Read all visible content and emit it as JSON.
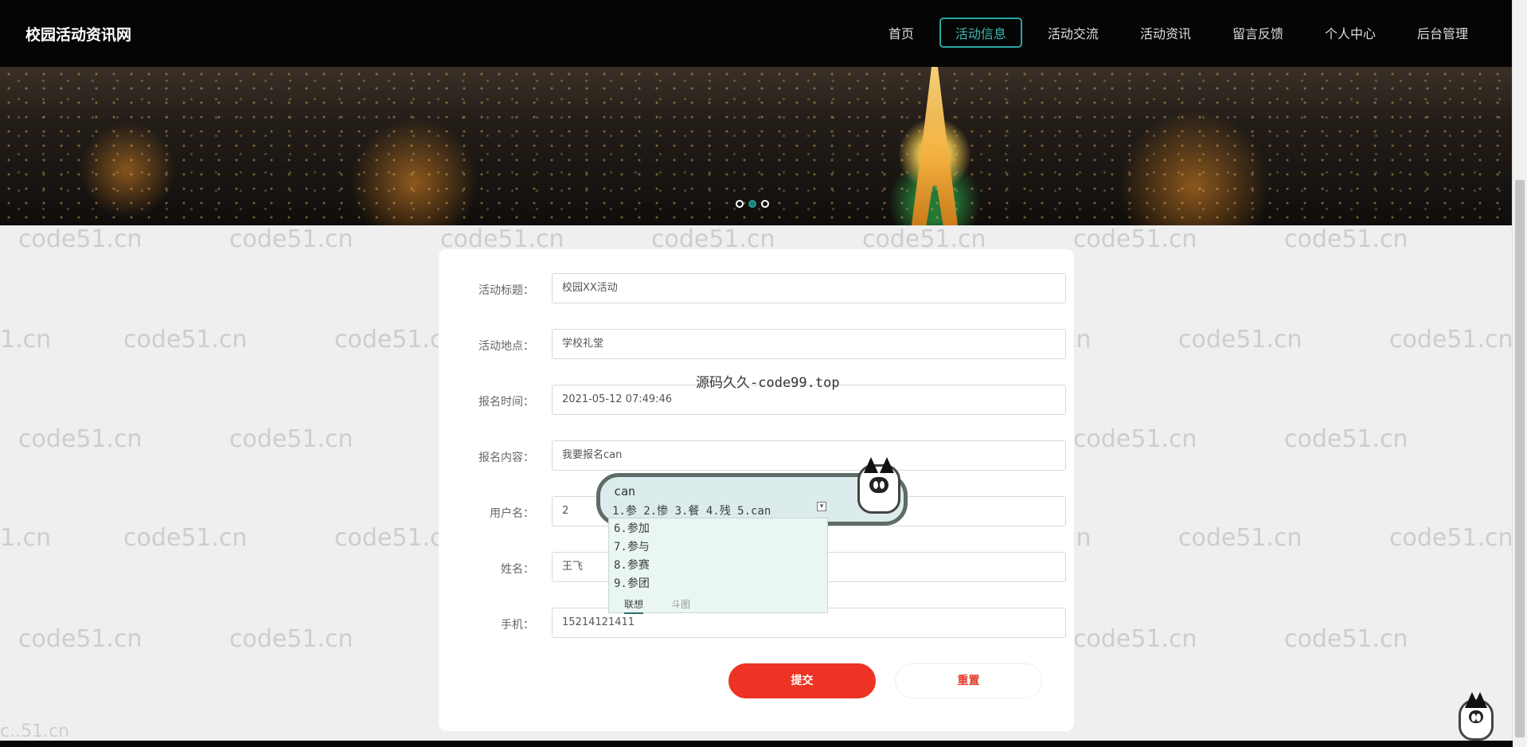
{
  "header": {
    "site_title": "校园活动资讯网",
    "nav": [
      "首页",
      "活动信息",
      "活动交流",
      "活动资讯",
      "留言反馈",
      "个人中心",
      "后台管理"
    ],
    "active_index": 1,
    "accent_color": "#2aa5a0"
  },
  "carousel": {
    "active_slide": 2,
    "slide_count": 3
  },
  "watermark": {
    "text": "code51.cn",
    "partial_text": "1.cn",
    "small_text": "c..51.cn"
  },
  "form": {
    "fields": [
      {
        "label": "活动标题：",
        "value": "校园XX活动"
      },
      {
        "label": "活动地点：",
        "value": "学校礼堂"
      },
      {
        "label": "报名时间：",
        "value": "2021-05-12 07:49:46"
      },
      {
        "label": "报名内容：",
        "value": "我要报名can"
      },
      {
        "label": "用户名：",
        "value": "2"
      },
      {
        "label": "姓名：",
        "value": "王飞"
      },
      {
        "label": "手机：",
        "value": "15214121411"
      }
    ],
    "submit_label": "提交",
    "reset_label": "重置",
    "primary_color": "#ec3324"
  },
  "overlay_text": "源码久久-code99.top",
  "ime": {
    "input": "can",
    "candidate_row": "1.参  2.惨  3.餐  4.残  5.can",
    "candidates": [
      "6.参加",
      "7.参与",
      "8.参赛",
      "9.参团"
    ],
    "tabs": [
      "联想",
      "斗图"
    ],
    "arrow_label": "▾",
    "accent_color": "#2e6f6b"
  }
}
